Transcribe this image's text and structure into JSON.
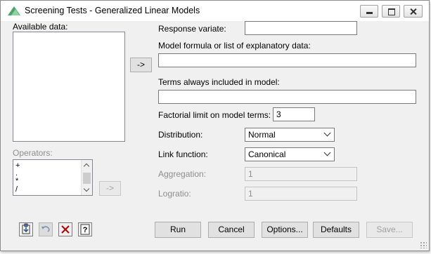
{
  "window": {
    "title": "Screening Tests - Generalized Linear Models"
  },
  "labels": {
    "available_data": "Available data:",
    "operators": "Operators:",
    "response_variate": "Response variate:",
    "model_formula": "Model formula or list of explanatory data:",
    "terms_always": "Terms always included in model:",
    "factorial_limit": "Factorial limit on model terms:",
    "distribution": "Distribution:",
    "link_function": "Link function:",
    "aggregation": "Aggregation:",
    "logratio": "Logratio:"
  },
  "fields": {
    "response_variate": "",
    "model_formula": "",
    "terms_always": "",
    "factorial_limit": "3",
    "distribution": "Normal",
    "link_function": "Canonical",
    "aggregation": "1",
    "logratio": "1"
  },
  "operators": [
    "+",
    ".",
    "*",
    "/"
  ],
  "arrow_buttons": {
    "data_arrow": "->",
    "ops_arrow": "->"
  },
  "buttons": {
    "run": "Run",
    "cancel": "Cancel",
    "options": "Options...",
    "defaults": "Defaults",
    "save": "Save..."
  },
  "toolbar_icons": [
    "pin-icon",
    "undo-icon",
    "clear-icon",
    "help-icon"
  ],
  "colors": {
    "titlebar": "#ffffff",
    "dialog_bg": "#f0f0f0",
    "disabled_text": "#8d8d8d",
    "clear_icon": "#c00000",
    "icon_green": "#4aa564"
  }
}
